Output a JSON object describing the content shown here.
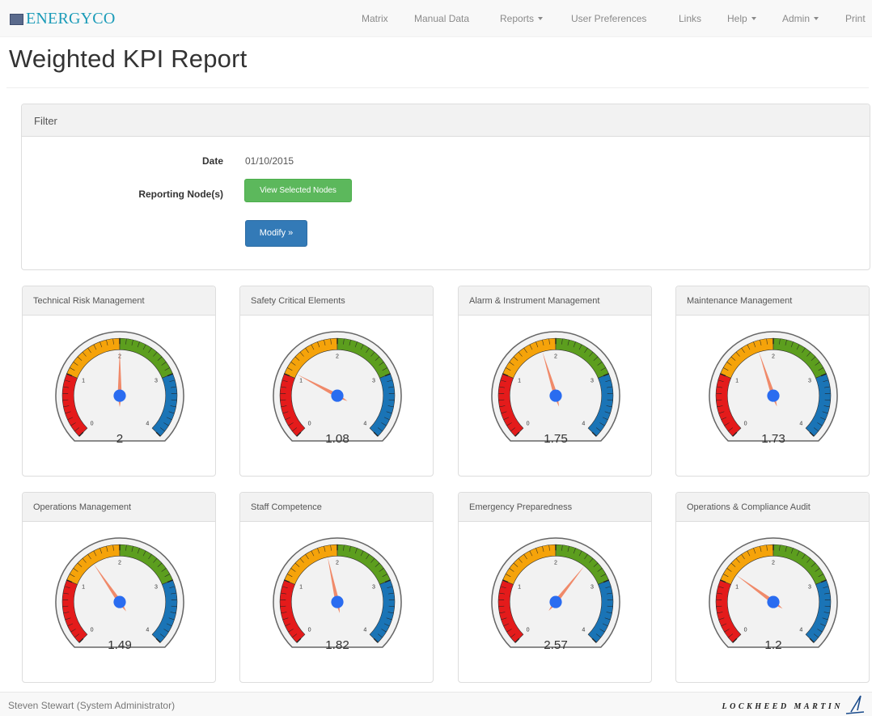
{
  "brand": {
    "name": "ENERGYCO"
  },
  "nav": [
    {
      "label": "Matrix",
      "dropdown": false
    },
    {
      "label": "Manual Data",
      "dropdown": false
    },
    {
      "label": "Reports",
      "dropdown": true
    },
    {
      "label": "User Preferences",
      "dropdown": false
    },
    {
      "label": "Links",
      "dropdown": false
    },
    {
      "label": "Help",
      "dropdown": true
    },
    {
      "label": "Admin",
      "dropdown": true
    },
    {
      "label": "Print",
      "dropdown": false
    }
  ],
  "page": {
    "title": "Weighted KPI Report"
  },
  "filter": {
    "title": "Filter",
    "date_label": "Date",
    "date_value": "01/10/2015",
    "nodes_label": "Reporting Node(s)",
    "view_nodes_button": "View Selected Nodes",
    "modify_button": "Modify »"
  },
  "gauge_scale": {
    "min": 0,
    "max": 4,
    "tick_labels": [
      "0",
      "1",
      "2",
      "3",
      "4"
    ],
    "bands": [
      {
        "from": 0,
        "to": 1,
        "color": "#e41b1b"
      },
      {
        "from": 1,
        "to": 2,
        "color": "#f5a30a"
      },
      {
        "from": 2,
        "to": 3,
        "color": "#5c9e1e"
      },
      {
        "from": 3,
        "to": 4,
        "color": "#1a74b6"
      }
    ],
    "needle_color": "#f08a6a",
    "hub_color": "#2a6cf0"
  },
  "kpis": [
    {
      "title": "Technical Risk Management",
      "value": 2,
      "display": "2"
    },
    {
      "title": "Safety Critical Elements",
      "value": 1.08,
      "display": "1.08"
    },
    {
      "title": "Alarm & Instrument Management",
      "value": 1.75,
      "display": "1.75"
    },
    {
      "title": "Maintenance Management",
      "value": 1.73,
      "display": "1.73"
    },
    {
      "title": "Operations Management",
      "value": 1.49,
      "display": "1.49"
    },
    {
      "title": "Staff Competence",
      "value": 1.82,
      "display": "1.82"
    },
    {
      "title": "Emergency Preparedness",
      "value": 2.57,
      "display": "2.57"
    },
    {
      "title": "Operations & Compliance Audit",
      "value": 1.2,
      "display": "1.2"
    }
  ],
  "footer": {
    "user": "Steven Stewart (System Administrator)",
    "logo_text": "LOCKHEED MARTIN"
  }
}
